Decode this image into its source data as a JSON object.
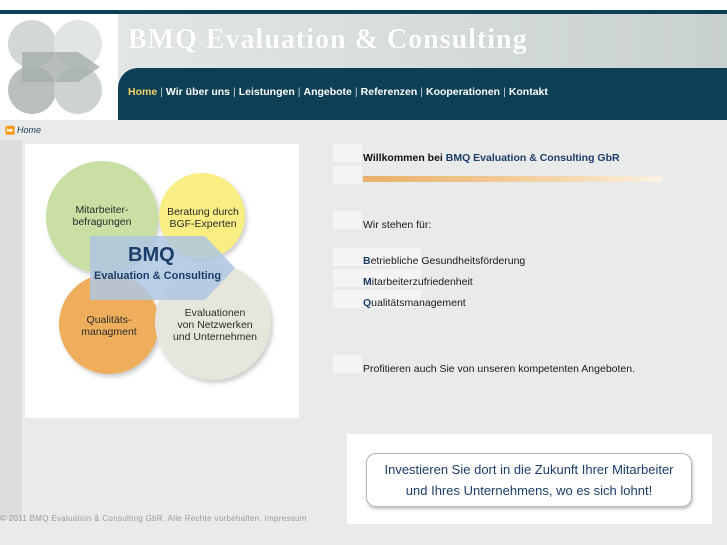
{
  "brand": {
    "title": "BMQ Evaluation & Consulting",
    "logo_icon": "bmq-circles-logo"
  },
  "nav": {
    "items": [
      {
        "label": "Home",
        "active": true
      },
      {
        "label": "Wir über uns"
      },
      {
        "label": "Leistungen"
      },
      {
        "label": "Angebote"
      },
      {
        "label": "Referenzen"
      },
      {
        "label": "Kooperationen"
      },
      {
        "label": "Kontakt"
      }
    ],
    "separator": "|"
  },
  "breadcrumb": {
    "arrow": "⏩",
    "label": "Home"
  },
  "diagram": {
    "circle_top_left": "Mitarbeiter-\nbefragungen",
    "circle_top_right": "Beratung durch\nBGF-Experten",
    "circle_bottom_left": "Qualitäts-\nmanagment",
    "circle_bottom_right": "Evaluationen\nvon Netzwerken\nund Unternehmen",
    "center_title": "BMQ",
    "center_subtitle": "Evaluation & Consulting"
  },
  "content": {
    "welcome_prefix": "Willkommen bei ",
    "welcome_company": "BMQ Evaluation & Consulting GbR",
    "intro": "Wir stehen für:",
    "services": [
      {
        "initial": "B",
        "rest": "etriebliche Gesundheitsförderung"
      },
      {
        "initial": "M",
        "rest": "itarbeiterzufriedenheit"
      },
      {
        "initial": "Q",
        "rest": "ualitätsmanagement"
      }
    ],
    "closing": "Profitieren auch Sie von unseren kompetenten Angeboten."
  },
  "banner": {
    "line1": "Investieren Sie dort in die Zukunft Ihrer Mitarbeiter",
    "line2": "und Ihres Unternehmens, wo es sich lohnt!"
  },
  "footer": {
    "text": "© 2011 BMQ Evaluation & Consulting GbR. Alle Rechte vorbehalten. ",
    "impressum": "Impressum"
  },
  "colors": {
    "navy": "#0d3f55",
    "accent_text": "#1c3d6a",
    "active_nav": "#f4d36a",
    "circle_green": "#c9dfa4",
    "circle_yellow": "#f8ee83",
    "circle_orange": "#eeae5c",
    "circle_grey": "#e6e6dd"
  }
}
